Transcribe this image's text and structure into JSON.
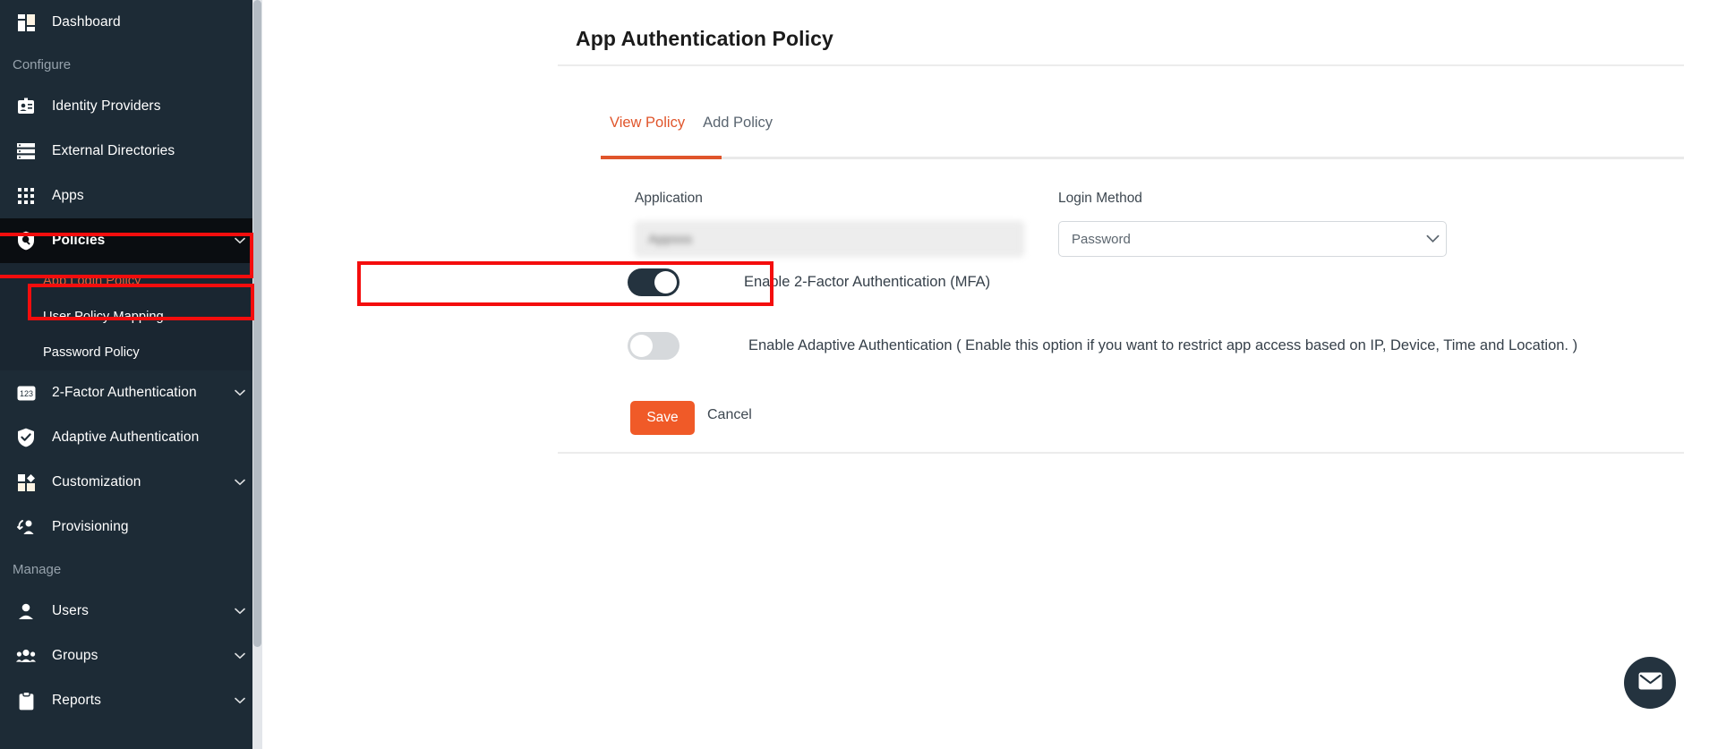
{
  "sidebar": {
    "scrollbar": {
      "name": "sidebar-scrollbar"
    },
    "top_items": [
      {
        "label": "Dashboard",
        "icon": "dashboard-icon",
        "chevron": false
      }
    ],
    "sections": [
      {
        "label": "Configure",
        "items": [
          {
            "label": "Identity Providers",
            "icon": "identity-providers-icon",
            "chevron": false
          },
          {
            "label": "External Directories",
            "icon": "external-directories-icon",
            "chevron": false
          },
          {
            "label": "Apps",
            "icon": "apps-grid-icon",
            "chevron": false
          },
          {
            "label": "Policies",
            "icon": "policies-shield-icon",
            "chevron": true,
            "active": true,
            "highlighted": true
          },
          {
            "label": "2-Factor Authentication",
            "icon": "two-factor-123-icon",
            "chevron": true
          },
          {
            "label": "Adaptive Authentication",
            "icon": "adaptive-shield-check-icon",
            "chevron": false
          },
          {
            "label": "Customization",
            "icon": "customization-icon",
            "chevron": true
          },
          {
            "label": "Provisioning",
            "icon": "provisioning-icon",
            "chevron": false
          }
        ]
      },
      {
        "label": "Manage",
        "items": [
          {
            "label": "Users",
            "icon": "user-icon",
            "chevron": true
          },
          {
            "label": "Groups",
            "icon": "groups-icon",
            "chevron": true
          },
          {
            "label": "Reports",
            "icon": "reports-clipboard-icon",
            "chevron": true
          }
        ]
      }
    ],
    "submenu": [
      {
        "label": "App Login Policy",
        "selected": true,
        "highlighted": true
      },
      {
        "label": "User Policy Mapping",
        "selected": false
      },
      {
        "label": "Password Policy",
        "selected": false
      }
    ]
  },
  "main": {
    "page_title": "App Authentication Policy",
    "tabs": [
      {
        "label": "View Policy",
        "active": true
      },
      {
        "label": "Add Policy",
        "active": false
      }
    ],
    "form": {
      "application": {
        "label": "Application",
        "value": "Appsss",
        "placeholder": ""
      },
      "login_method": {
        "label": "Login Method",
        "value": "Password",
        "options": [
          "Password"
        ]
      },
      "mfa_toggle": {
        "label": "Enable 2-Factor Authentication (MFA)",
        "state": "on"
      },
      "adaptive_toggle": {
        "label": "Enable Adaptive Authentication ( Enable this option if you want to restrict app access based on IP, Device, Time and Location. )",
        "state": "off"
      },
      "save_label": "Save",
      "cancel_label": "Cancel"
    }
  },
  "fab": {
    "icon": "mail-icon"
  },
  "colors": {
    "sidebar_bg": "#1d2b36",
    "sidebar_active_bg": "#0a0d11",
    "submenu_bg": "#1a2631",
    "accent_orange": "#e0552b",
    "save_orange": "#f05a28",
    "selected_link": "#e0643a",
    "highlight_red": "#f40d0d",
    "toggle_on": "#24333f",
    "toggle_off": "#d6d9dc"
  }
}
